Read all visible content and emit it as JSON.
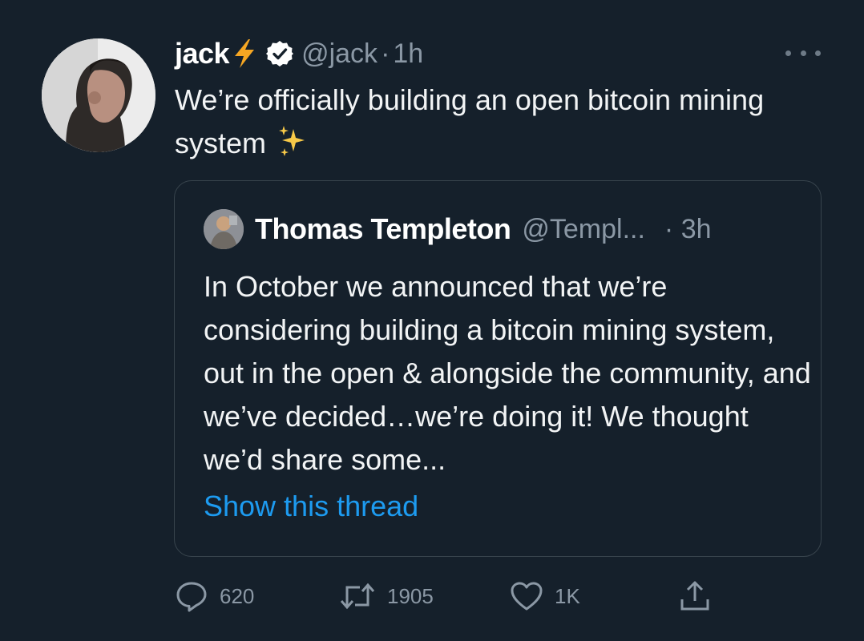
{
  "tweet": {
    "author_name": "jack",
    "handle": "@jack",
    "separator": "·",
    "time": "1h",
    "text": "We’re officially building an open bitcoin mining system"
  },
  "quote": {
    "author_name": "Thomas Templeton",
    "handle": "@Templ...",
    "time": "· 3h",
    "text": "In October we announced that we’re considering building a bitcoin mining system, out in the open & alongside the community, and we’ve decided…we’re doing it! We thought we’d share some...",
    "show_thread": "Show this thread"
  },
  "actions": {
    "reply_count": "620",
    "retweet_count": "1905",
    "like_count": "1K"
  },
  "icons": {
    "reply": "reply-icon",
    "retweet": "retweet-icon",
    "like": "heart-icon",
    "share": "share-icon",
    "more": "more-icon",
    "verified": "verified-badge-icon",
    "bolt": "lightning-bolt-icon",
    "sparkles": "sparkles-icon"
  },
  "colors": {
    "background": "#15202b",
    "link": "#1d9bf0",
    "secondary_text": "#8b98a5",
    "border": "#38444d"
  }
}
